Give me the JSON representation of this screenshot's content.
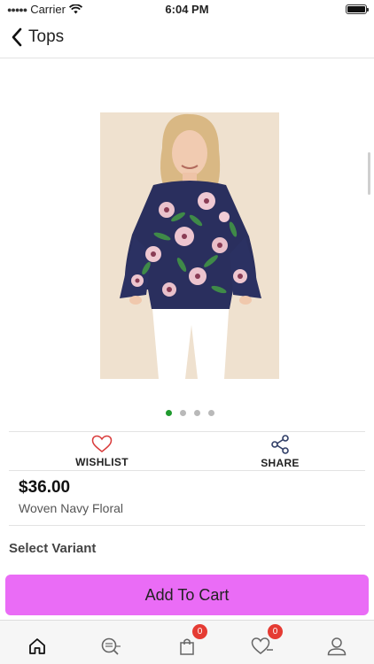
{
  "status_bar": {
    "carrier": "Carrier",
    "time": "6:04 PM"
  },
  "nav": {
    "back_label": "Tops"
  },
  "gallery": {
    "image_count": 4,
    "active_index": 0,
    "active_dot_color": "#1f9a2e"
  },
  "actions": {
    "wishlist_label": "WISHLIST",
    "share_label": "SHARE"
  },
  "product": {
    "price": "$36.00",
    "name": "Woven Navy Floral"
  },
  "variant": {
    "title": "Select Variant"
  },
  "cart_button": {
    "label": "Add To Cart",
    "color": "#ea6cf6"
  },
  "tab_bar": {
    "items": [
      "home-icon",
      "search-icon",
      "cart-icon",
      "wishlist-icon",
      "profile-icon"
    ],
    "cart_badge": "0",
    "wishlist_badge": "0"
  }
}
